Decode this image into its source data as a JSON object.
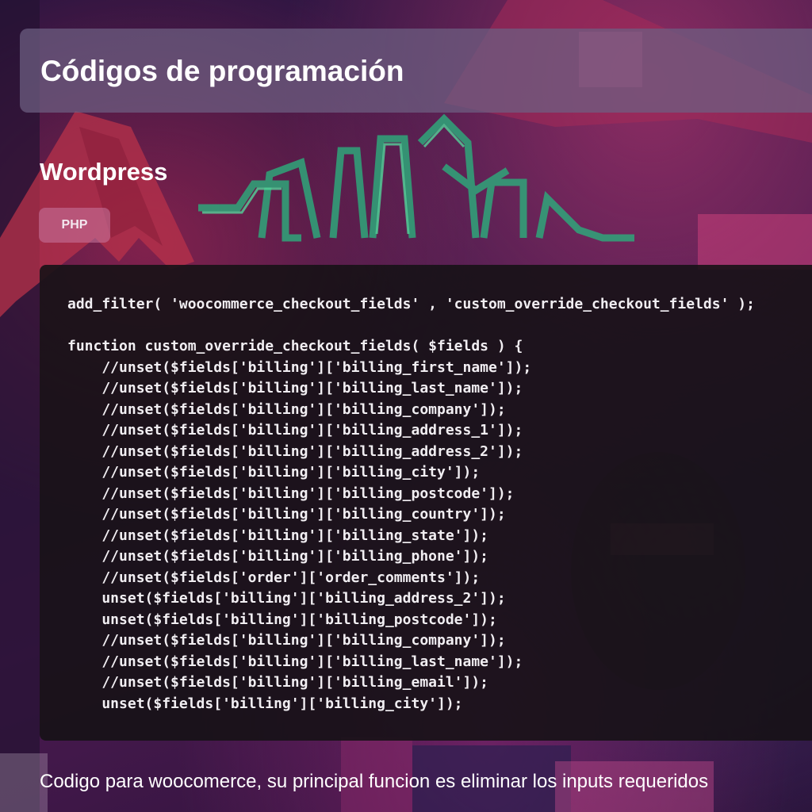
{
  "header": {
    "title": "Códigos de programación"
  },
  "section": {
    "title": "Wordpress",
    "language_badge": "PHP"
  },
  "code": {
    "lines": [
      "add_filter( 'woocommerce_checkout_fields' , 'custom_override_checkout_fields' );",
      "",
      "function custom_override_checkout_fields( $fields ) {",
      "    //unset($fields['billing']['billing_first_name']);",
      "    //unset($fields['billing']['billing_last_name']);",
      "    //unset($fields['billing']['billing_company']);",
      "    //unset($fields['billing']['billing_address_1']);",
      "    //unset($fields['billing']['billing_address_2']);",
      "    //unset($fields['billing']['billing_city']);",
      "    //unset($fields['billing']['billing_postcode']);",
      "    //unset($fields['billing']['billing_country']);",
      "    //unset($fields['billing']['billing_state']);",
      "    //unset($fields['billing']['billing_phone']);",
      "    //unset($fields['order']['order_comments']);",
      "    unset($fields['billing']['billing_address_2']);",
      "    unset($fields['billing']['billing_postcode']);",
      "    //unset($fields['billing']['billing_company']);",
      "    //unset($fields['billing']['billing_last_name']);",
      "    //unset($fields['billing']['billing_email']);",
      "    unset($fields['billing']['billing_city']);"
    ]
  },
  "description": {
    "text": "Codigo para woocomerce, su principal funcion es eliminar los inputs requeridos"
  },
  "colors": {
    "background": "#3a1a4a",
    "title_bar": "#6e5f82",
    "badge": "#c878a0",
    "code_background": "#161216",
    "code_text": "#f1eef2"
  }
}
